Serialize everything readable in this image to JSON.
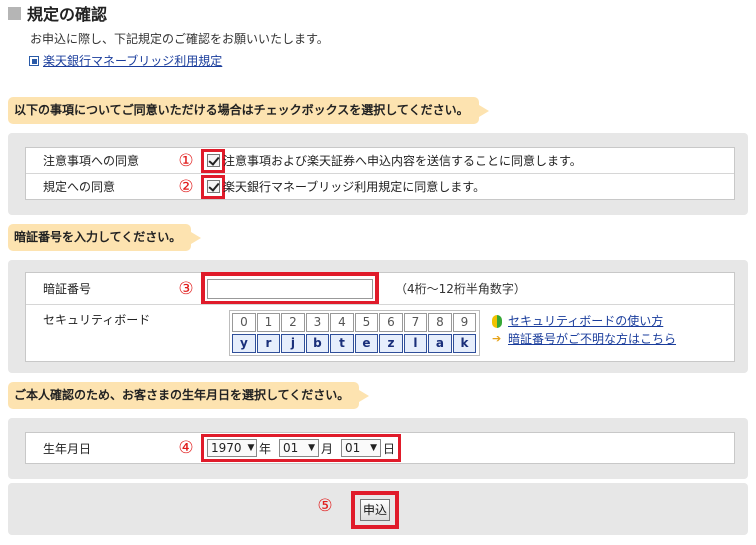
{
  "page": {
    "title": "規定の確認",
    "intro": "お申込に際し、下記規定のご確認をお願いいたします。",
    "rule_link": "楽天銀行マネーブリッジ利用規定"
  },
  "agreement": {
    "label": "以下の事項についてご同意いただける場合はチェックボックスを選択してください。",
    "rows": [
      {
        "number": "①",
        "label": "注意事項への同意",
        "text": "注意事項および楽天証券へ申込内容を送信することに同意します。",
        "checked": true
      },
      {
        "number": "②",
        "label": "規定への同意",
        "text": "楽天銀行マネーブリッジ利用規定に同意します。",
        "checked": true
      }
    ]
  },
  "pin": {
    "label": "暗証番号を入力してください。",
    "number": "③",
    "field_label": "暗証番号",
    "value": "",
    "hint": "（4桁～12桁半角数字）",
    "keyboard_label": "セキュリティボード",
    "digits": [
      "0",
      "1",
      "2",
      "3",
      "4",
      "5",
      "6",
      "7",
      "8",
      "9"
    ],
    "letters": [
      "y",
      "r",
      "j",
      "b",
      "t",
      "e",
      "z",
      "l",
      "a",
      "k"
    ],
    "links": [
      "セキュリティボードの使い方",
      "暗証番号がご不明な方はこちら"
    ]
  },
  "dob": {
    "label": "ご本人確認のため、お客さまの生年月日を選択してください。",
    "number": "④",
    "field_label": "生年月日",
    "year": "1970",
    "year_unit": "年",
    "month": "01",
    "month_unit": "月",
    "day": "01",
    "day_unit": "日"
  },
  "submit": {
    "number": "⑤",
    "label": "申込"
  },
  "colors": {
    "highlight_red": "#e01b2a",
    "section_label_bg": "#fde3b0",
    "panel_bg": "#e7e7e7",
    "link": "#1a3d9c"
  }
}
